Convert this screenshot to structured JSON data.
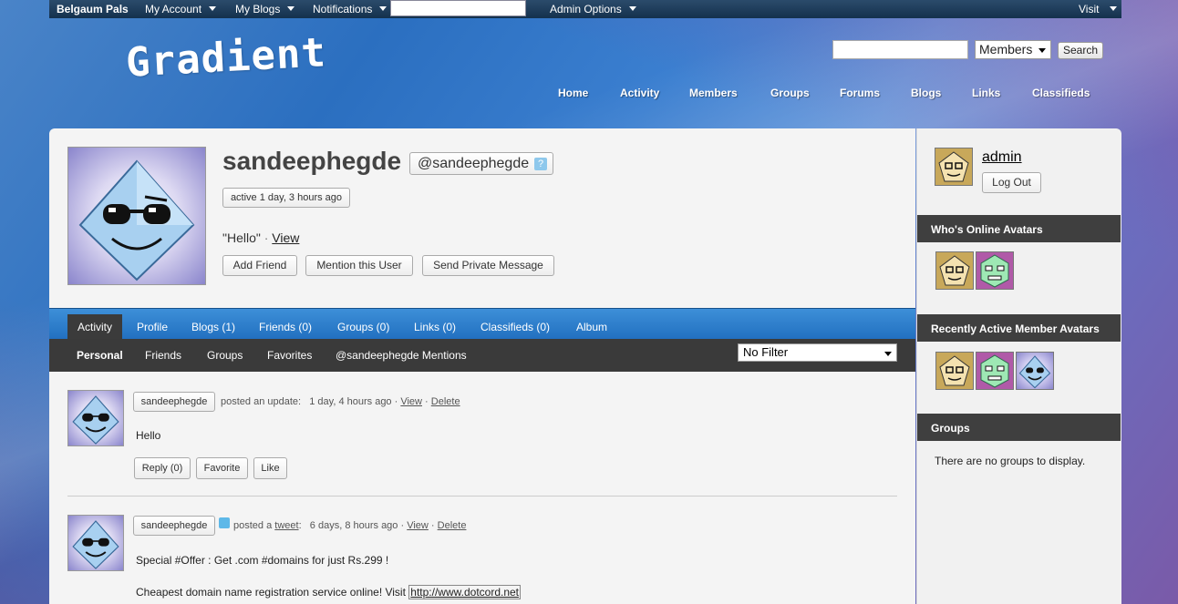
{
  "adminbar": {
    "brand": "Belgaum Pals",
    "my_account": "My Account",
    "my_blogs": "My Blogs",
    "notifications": "Notifications",
    "admin_options": "Admin Options",
    "visit": "Visit"
  },
  "header": {
    "logo": "Gradient",
    "search_select": "Members",
    "search_button": "Search",
    "nav": [
      "Home",
      "Activity",
      "Members",
      "Groups",
      "Forums",
      "Blogs",
      "Links",
      "Classifieds"
    ]
  },
  "profile": {
    "username": "sandeephegde",
    "handle": "@sandeephegde",
    "help": "?",
    "active": "active 1 day, 3 hours ago",
    "status_text": "\"Hello\"",
    "status_sep": "·",
    "status_view": "View",
    "add_friend": "Add Friend",
    "mention": "Mention this User",
    "private_message": "Send Private Message"
  },
  "tabs": [
    "Activity",
    "Profile",
    "Blogs (1)",
    "Friends (0)",
    "Groups (0)",
    "Links (0)",
    "Classifieds (0)",
    "Album"
  ],
  "subtabs": [
    "Personal",
    "Friends",
    "Groups",
    "Favorites",
    "@sandeephegde Mentions"
  ],
  "filter": "No Filter",
  "activity": [
    {
      "user": "sandeephegde",
      "action": "posted an update:",
      "time": "1 day, 4 hours ago",
      "view": "View",
      "delete": "Delete",
      "text": "Hello",
      "reply": "Reply (0)",
      "favorite": "Favorite",
      "like": "Like"
    },
    {
      "user": "sandeephegde",
      "action": "posted a",
      "action_link": "tweet",
      "time": "6 days, 8 hours ago",
      "view": "View",
      "delete": "Delete",
      "text1": "Special #Offer : Get .com #domains for just Rs.299 !",
      "text2": "Cheapest domain name registration service online! Visit",
      "link": "http://www.dotcord.net"
    }
  ],
  "sidebar": {
    "user": "admin",
    "logout": "Log Out",
    "whos_online": "Who's Online Avatars",
    "recently_active": "Recently Active Member Avatars",
    "groups": "Groups",
    "no_groups": "There are no groups to display."
  },
  "colors": {
    "tabbar": "#2f7fcf",
    "subbar": "#3a3a3a",
    "sidebar_head": "#3f3f3f"
  }
}
